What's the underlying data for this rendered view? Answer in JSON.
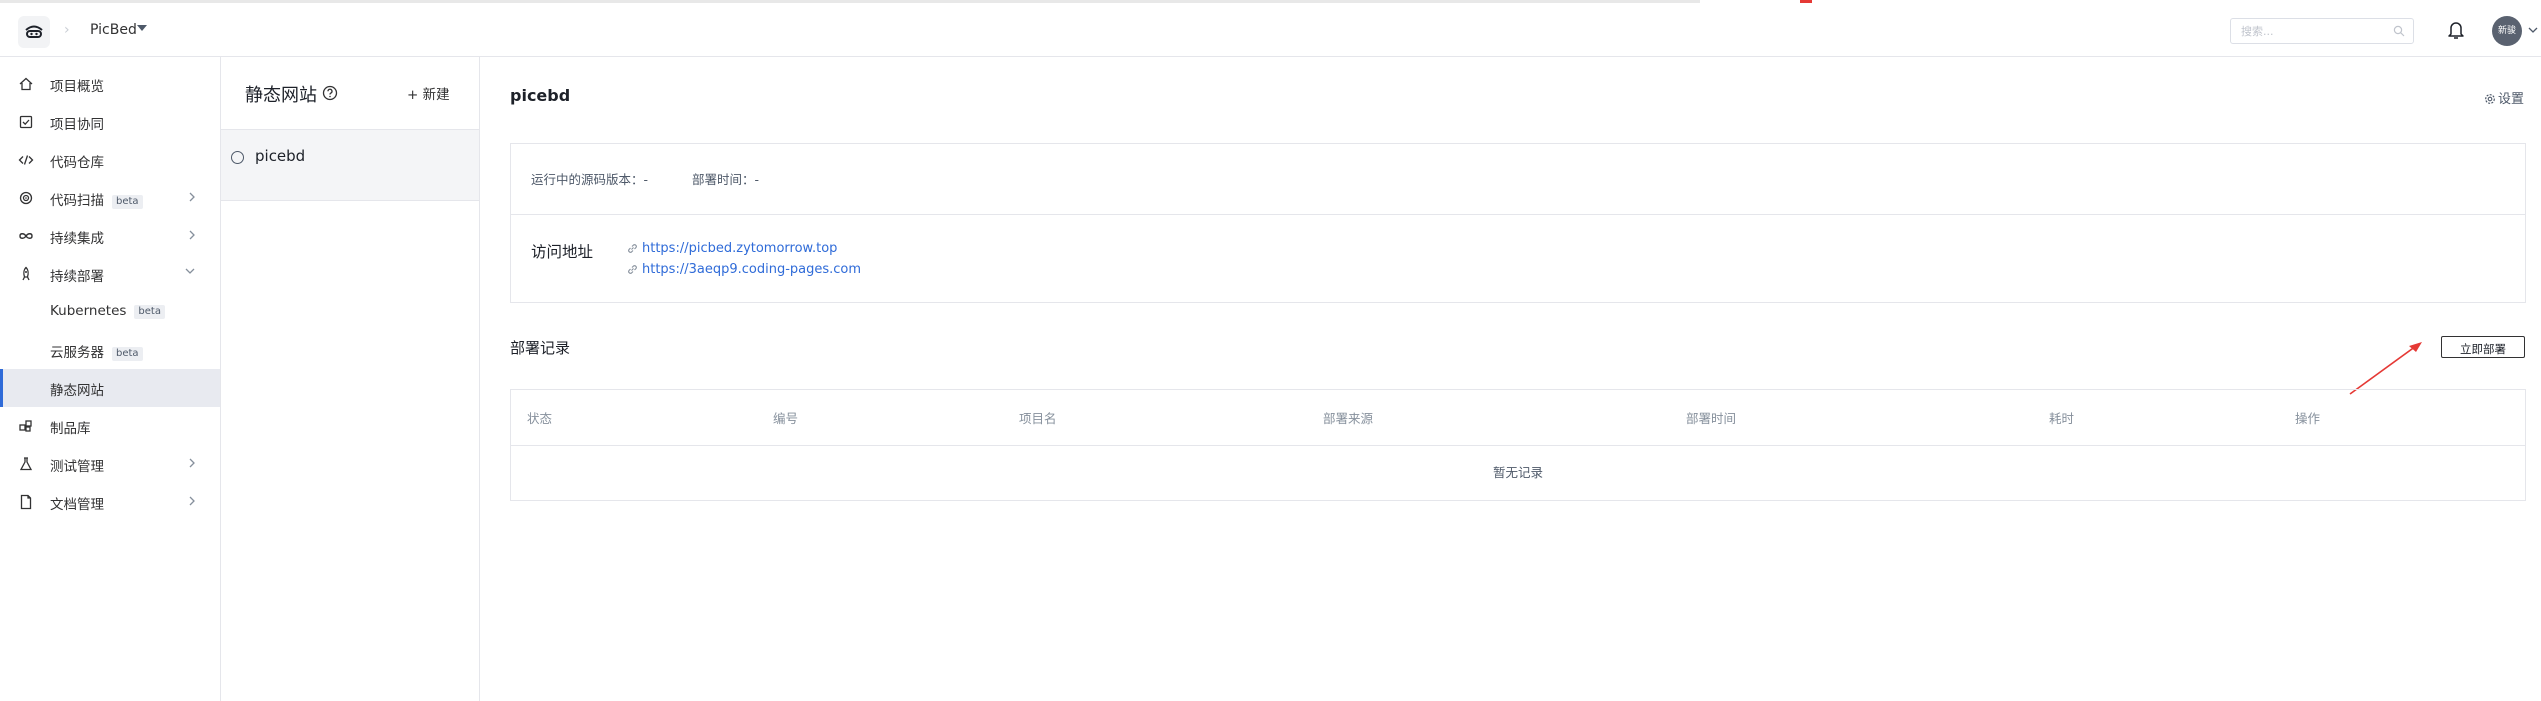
{
  "header": {
    "project_name": "PicBed",
    "search_placeholder": "搜索...",
    "avatar_text": "新骏"
  },
  "sidebar": {
    "items": [
      {
        "label": "项目概览",
        "icon": "home-icon"
      },
      {
        "label": "项目协同",
        "icon": "checkbox-icon"
      },
      {
        "label": "代码仓库",
        "icon": "code-icon"
      },
      {
        "label": "代码扫描",
        "icon": "scan-icon",
        "badge": "beta"
      },
      {
        "label": "持续集成",
        "icon": "infinity-icon"
      },
      {
        "label": "持续部署",
        "icon": "rocket-icon"
      },
      {
        "label": "Kubernetes",
        "badge": "beta"
      },
      {
        "label": "云服务器",
        "badge": "beta"
      },
      {
        "label": "静态网站"
      },
      {
        "label": "制品库",
        "icon": "artifact-icon"
      },
      {
        "label": "测试管理",
        "icon": "flask-icon"
      },
      {
        "label": "文档管理",
        "icon": "document-icon"
      }
    ]
  },
  "sites": {
    "title": "静态网站",
    "new_label": "+ 新建",
    "items": [
      {
        "name": "picebd"
      }
    ]
  },
  "main": {
    "title": "picebd",
    "settings_label": "设置",
    "source_version": "运行中的源码版本：-",
    "deploy_time": "部署时间：-",
    "access_label": "访问地址",
    "links": [
      "https://picbed.zytomorrow.top",
      "https://3aeqp9.coding-pages.com"
    ],
    "records_title": "部署记录",
    "deploy_button": "立即部署",
    "table": {
      "columns": [
        "状态",
        "编号",
        "项目名",
        "部署来源",
        "部署时间",
        "耗时",
        "操作"
      ],
      "empty_text": "暂无记录"
    }
  },
  "colors": {
    "accent": "#2f6bd8",
    "arrow": "#e53935",
    "active_bg": "#e8eaf0"
  }
}
